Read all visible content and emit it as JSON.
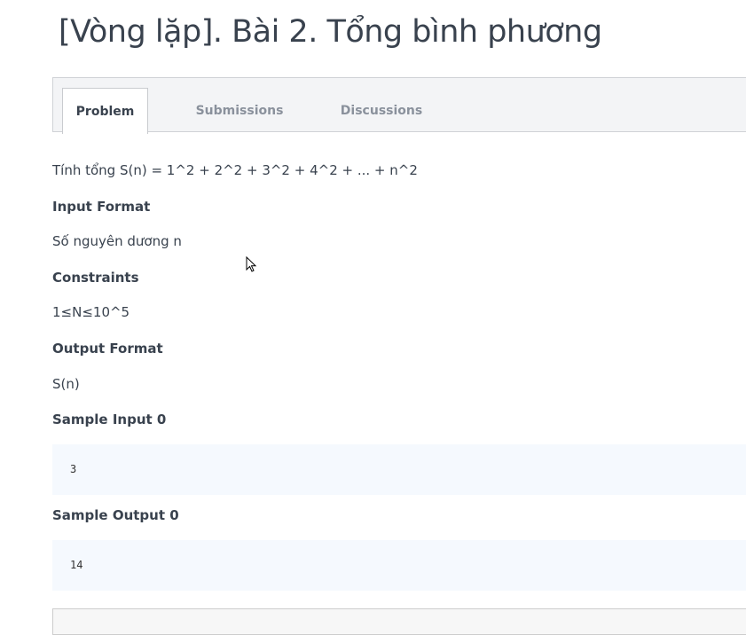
{
  "title": "[Vòng lặp]. Bài 2. Tổng bình phương",
  "tabs": [
    {
      "label": "Problem"
    },
    {
      "label": "Submissions"
    },
    {
      "label": "Discussions"
    }
  ],
  "problem": {
    "statement": "Tính tổng S(n) = 1^2 + 2^2 + 3^2 + 4^2 + ... + n^2",
    "input_format_heading": "Input Format",
    "input_format": "Số nguyên dương n",
    "constraints_heading": "Constraints",
    "constraints": "1≤N≤10^5",
    "output_format_heading": "Output Format",
    "output_format": "S(n)",
    "sample_input_heading": "Sample Input 0",
    "sample_input": "3",
    "sample_output_heading": "Sample Output 0",
    "sample_output": "14"
  }
}
